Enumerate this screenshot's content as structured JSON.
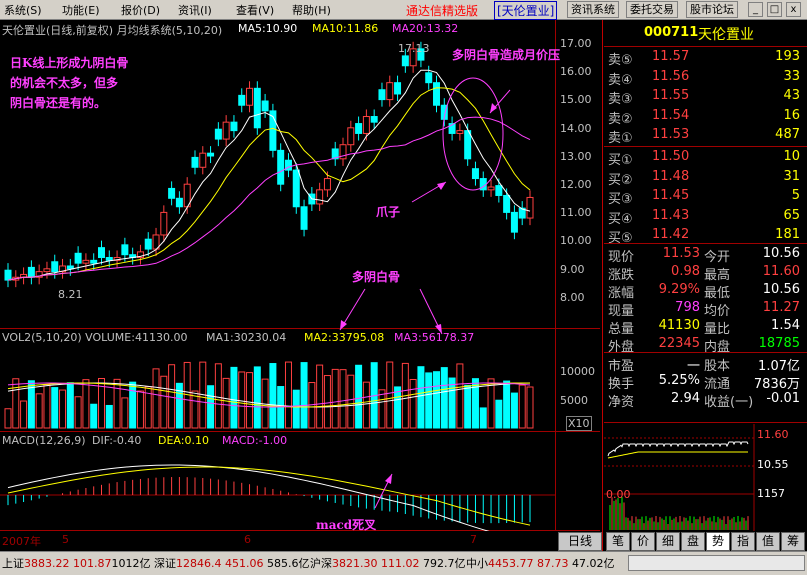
{
  "menu": [
    "系统",
    "(S)",
    "功能",
    "(E)",
    "报价",
    "(D)",
    "资讯",
    "(I)",
    "查看",
    "(V)",
    "帮助",
    "(H)"
  ],
  "app_title": "通达信精选版",
  "window_stock": "[天伦置业]",
  "top_buttons": [
    "资讯系统",
    "委托交易",
    "股市论坛"
  ],
  "window_buttons": [
    "_",
    "□",
    "x"
  ],
  "chart_header": {
    "title": "天伦置业(日线,前复权) 月均线系统(5,10,20)",
    "ma5": "MA5:10.90",
    "ma10": "MA10:11.86",
    "ma20": "MA20:13.32",
    "high_mark": "17.13",
    "low_mark": "8.21",
    "color_ma5": "#ffffff",
    "color_ma10": "#ffff00",
    "color_ma20": "#ff40ff"
  },
  "price_axis": [
    "17.00",
    "16.00",
    "15.00",
    "14.00",
    "13.00",
    "12.00",
    "11.00",
    "10.00",
    "9.00",
    "8.00"
  ],
  "volume_header": {
    "title": "VOL2(5,10,20) VOLUME:41130.00",
    "ma1": "MA1:30230.04",
    "ma2": "MA2:33795.08",
    "ma3": "MA3:56178.37"
  },
  "volume_axis": [
    "10000",
    "5000",
    "X10"
  ],
  "macd_header": {
    "title": "MACD(12,26,9)",
    "dif": "DIF:-0.40",
    "dea": "DEA:0.10",
    "macd": "MACD:-1.00"
  },
  "date_axis": [
    "2007年",
    "5",
    "6",
    "7"
  ],
  "annotations": {
    "top_left": [
      "日K线上形成九阴白骨",
      "的机会不太多，但多",
      "阴白骨还是有的。"
    ],
    "top_right": "多阴白骨造成月价压",
    "claw": "爪子",
    "middle": "多阴白骨",
    "macd": "macd死叉"
  },
  "quote": {
    "code": "000711",
    "name": "天伦置业",
    "asks": [
      {
        "label": "卖⑤",
        "price": "11.57",
        "vol": "193"
      },
      {
        "label": "卖④",
        "price": "11.56",
        "vol": "33"
      },
      {
        "label": "卖③",
        "price": "11.55",
        "vol": "43"
      },
      {
        "label": "卖②",
        "price": "11.54",
        "vol": "16"
      },
      {
        "label": "卖①",
        "price": "11.53",
        "vol": "487"
      }
    ],
    "bids": [
      {
        "label": "买①",
        "price": "11.50",
        "vol": "10"
      },
      {
        "label": "买②",
        "price": "11.48",
        "vol": "31"
      },
      {
        "label": "买③",
        "price": "11.45",
        "vol": "5"
      },
      {
        "label": "买④",
        "price": "11.43",
        "vol": "65"
      },
      {
        "label": "买⑤",
        "price": "11.42",
        "vol": "181"
      }
    ],
    "stats": [
      {
        "l1": "现价",
        "v1": "11.53",
        "l2": "今开",
        "v2": "10.56",
        "c1": "#ff4040",
        "c2": "#ffffff"
      },
      {
        "l1": "涨跌",
        "v1": "0.98",
        "l2": "最高",
        "v2": "11.60",
        "c1": "#ff4040",
        "c2": "#ff4040"
      },
      {
        "l1": "涨幅",
        "v1": "9.29%",
        "l2": "最低",
        "v2": "10.56",
        "c1": "#ff4040",
        "c2": "#ffffff"
      },
      {
        "l1": "现量",
        "v1": "798",
        "l2": "均价",
        "v2": "11.27",
        "c1": "#ff40ff",
        "c2": "#ff4040"
      },
      {
        "l1": "总量",
        "v1": "41130",
        "l2": "量比",
        "v2": "1.54",
        "c1": "#ffff00",
        "c2": "#ffffff"
      },
      {
        "l1": "外盘",
        "v1": "22345",
        "l2": "内盘",
        "v2": "18785",
        "c1": "#ff4040",
        "c2": "#00ff00"
      },
      {
        "l1": "市盈",
        "v1": "一",
        "l2": "股本",
        "v2": "1.07亿",
        "c1": "#ffffff",
        "c2": "#ffffff"
      },
      {
        "l1": "换手",
        "v1": "5.25%",
        "l2": "流通",
        "v2": "7836万",
        "c1": "#ffffff",
        "c2": "#ffffff"
      },
      {
        "l1": "净资",
        "v1": "2.94",
        "l2": "收益(一)",
        "v2": "-0.01",
        "c1": "#ffffff",
        "c2": "#ffffff"
      }
    ]
  },
  "mini_chart": {
    "high": "11.60",
    "mid": "10.55",
    "zero": "0.00",
    "vol": "1157"
  },
  "left_tab": "日线",
  "right_tabs": [
    "笔",
    "价",
    "细",
    "盘",
    "势",
    "指",
    "值",
    "筹"
  ],
  "status": {
    "sh_label": "上证",
    "sh_val": "3883.22",
    "sh_chg": "101.87",
    "sh_amt": "1012亿",
    "sz_label": "深证",
    "sz_val": "12846.4",
    "sz_chg": "451.06",
    "sz_amt": "585.6亿",
    "hs_label": "沪深",
    "hs_val": "3821.30",
    "hs_chg": "111.02",
    "hs_amt": "792.7亿",
    "zx_label": "中小",
    "zx_val": "4453.77",
    "zx_chg": "87.73",
    "zx_amt": "47.02亿"
  }
}
